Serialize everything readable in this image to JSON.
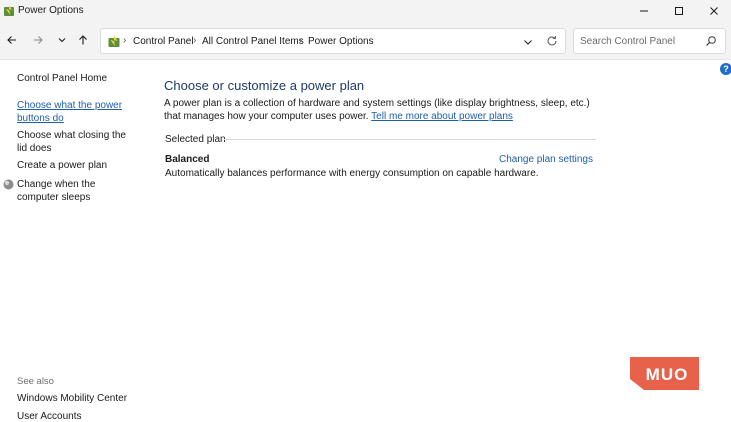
{
  "window": {
    "title": "Power Options",
    "icon": "power-options-icon",
    "controls": {
      "minimize": "minimize-icon",
      "maximize": "maximize-icon",
      "close": "close-icon"
    }
  },
  "navigation": {
    "back_icon": "arrow-left-icon",
    "forward_icon": "arrow-right-icon",
    "recent_icon": "chevron-down-icon",
    "up_icon": "arrow-up-icon",
    "breadcrumbs": [
      "Control Panel",
      "All Control Panel Items",
      "Power Options"
    ],
    "refresh_icon": "refresh-icon"
  },
  "search": {
    "placeholder": "Search Control Panel",
    "value": ""
  },
  "sidebar": {
    "home": "Control Panel Home",
    "tasks": [
      "Choose what the power buttons do",
      "Choose what closing the lid does",
      "Create a power plan",
      "Change when the computer sleeps"
    ],
    "see_also_heading": "See also",
    "see_also": [
      "Windows Mobility Center",
      "User Accounts"
    ]
  },
  "main": {
    "title": "Choose or customize a power plan",
    "description": "A power plan is a collection of hardware and system settings (like display brightness, sleep, etc.) that manages how your computer uses power.",
    "learn_more": "Tell me more about power plans",
    "section_label": "Selected plan",
    "plan": {
      "name": "Balanced",
      "description": "Automatically balances performance with energy consumption on capable hardware.",
      "change_link": "Change plan settings"
    }
  },
  "watermark": {
    "text": "MUO",
    "color": "#e8614a"
  },
  "colors": {
    "link": "#1f5ea8",
    "title": "#1e3a66",
    "help": "#1f6fc5"
  }
}
